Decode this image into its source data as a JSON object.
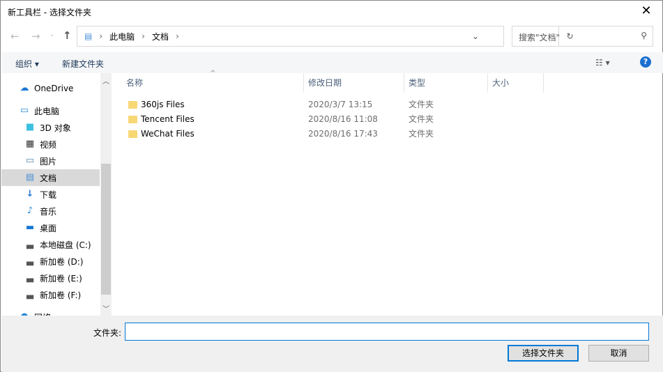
{
  "window": {
    "title": "新工具栏 - 选择文件夹"
  },
  "address": {
    "path": [
      "此电脑",
      "文档"
    ]
  },
  "search": {
    "placeholder": "搜索\"文档\""
  },
  "toolbar": {
    "organize": "组织",
    "new_folder": "新建文件夹"
  },
  "sidebar": {
    "items": [
      {
        "label": "OneDrive",
        "icon": "cloud-icon"
      },
      {
        "label": "此电脑",
        "icon": "computer-icon"
      },
      {
        "label": "3D 对象",
        "icon": "cube-icon"
      },
      {
        "label": "视频",
        "icon": "video-icon"
      },
      {
        "label": "图片",
        "icon": "picture-icon"
      },
      {
        "label": "文档",
        "icon": "document-icon",
        "selected": true
      },
      {
        "label": "下载",
        "icon": "download-icon"
      },
      {
        "label": "音乐",
        "icon": "music-icon"
      },
      {
        "label": "桌面",
        "icon": "desktop-icon"
      },
      {
        "label": "本地磁盘 (C:)",
        "icon": "drive-icon"
      },
      {
        "label": "新加卷 (D:)",
        "icon": "drive-icon"
      },
      {
        "label": "新加卷 (E:)",
        "icon": "drive-icon"
      },
      {
        "label": "新加卷 (F:)",
        "icon": "drive-icon"
      },
      {
        "label": "网络",
        "icon": "network-icon"
      }
    ]
  },
  "columns": [
    "名称",
    "修改日期",
    "类型",
    "大小"
  ],
  "files": [
    {
      "name": "360js Files",
      "date": "2020/3/7 13:15",
      "type": "文件夹"
    },
    {
      "name": "Tencent Files",
      "date": "2020/8/16 11:08",
      "type": "文件夹"
    },
    {
      "name": "WeChat Files",
      "date": "2020/8/16 17:43",
      "type": "文件夹"
    }
  ],
  "footer": {
    "folder_label": "文件夹:",
    "folder_value": "",
    "select_button": "选择文件夹",
    "cancel_button": "取消"
  }
}
